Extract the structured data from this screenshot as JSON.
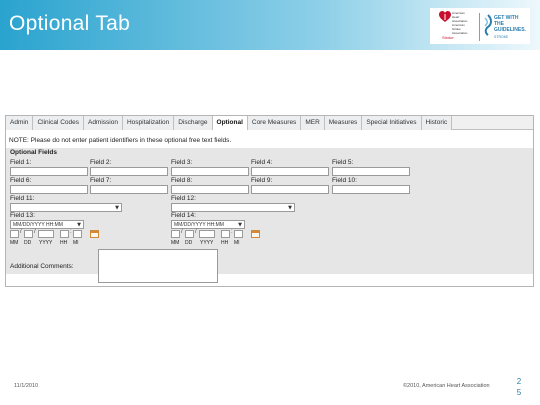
{
  "slide": {
    "title": "Optional Tab",
    "footer_date": "11/1/2010",
    "footer_copyright": "©2010, American Heart Association",
    "page_number": "2\n5"
  },
  "logos": {
    "aha_name": "American Heart Association. American Stroke Association.",
    "aha_tagline": "Stroke",
    "gwtg_name": "GET WITH THE GUIDELINES.",
    "gwtg_sub": "STROKE",
    "heart_color": "#c8102e",
    "gwtg_color": "#2a7fb0"
  },
  "tabs": [
    {
      "label": "Admin",
      "active": false
    },
    {
      "label": "Clinical Codes",
      "active": false
    },
    {
      "label": "Admission",
      "active": false
    },
    {
      "label": "Hospitalization",
      "active": false
    },
    {
      "label": "Discharge",
      "active": false
    },
    {
      "label": "Optional",
      "active": true
    },
    {
      "label": "Core Measures",
      "active": false
    },
    {
      "label": "MER",
      "active": false
    },
    {
      "label": "Measures",
      "active": false
    },
    {
      "label": "Special Initiatives",
      "active": false
    },
    {
      "label": "Historic",
      "active": false
    }
  ],
  "form": {
    "note": "NOTE: Please do not enter patient identifiers in these optional free text fields.",
    "section_title": "Optional Fields",
    "fields": {
      "f1": "Field 1:",
      "f2": "Field 2:",
      "f3": "Field 3:",
      "f4": "Field 4:",
      "f5": "Field 5:",
      "f6": "Field 6:",
      "f7": "Field 7:",
      "f8": "Field 8:",
      "f9": "Field 9:",
      "f10": "Field 10:",
      "f11": "Field 11:",
      "f12": "Field 12:",
      "f13": "Field 13:",
      "f14": "Field 14:"
    },
    "date_format": "MM/DD/YYYY HH:MM",
    "date_caps": {
      "mm": "MM",
      "dd": "DD",
      "yyyy": "YYYY",
      "hh": "HH",
      "mi": "MI"
    },
    "additional_comments": "Additional Comments:",
    "select_arrow": "▼"
  }
}
